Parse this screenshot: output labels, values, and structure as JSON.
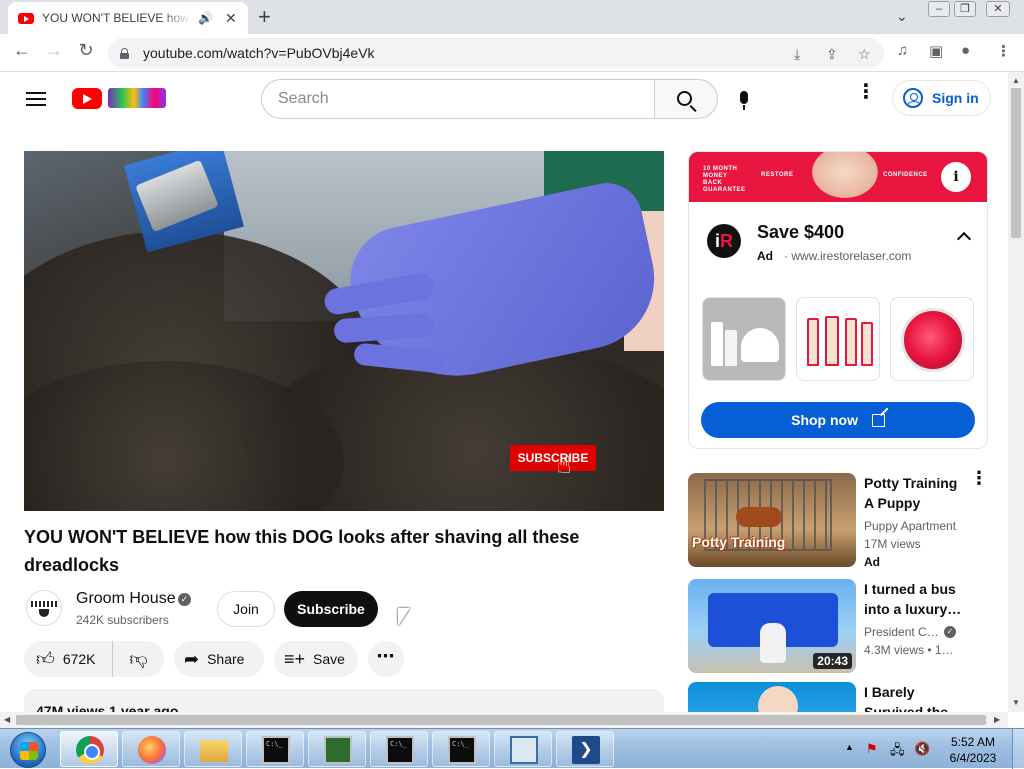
{
  "browser": {
    "tab_title": "YOU WON'T BELIEVE how this DOG looks after shaving all these dreadlocks",
    "url": "youtube.com/watch?v=PubOVbj4eVk",
    "audio_icon": "speaker-icon",
    "close_icon": "close-icon",
    "new_tab_icon": "plus-icon"
  },
  "youtube": {
    "search_placeholder": "Search",
    "sign_in": "Sign in"
  },
  "video": {
    "title": "YOU WON'T BELIEVE how this DOG looks after shaving all these dreadlocks",
    "overlay_subscribe": "SUBSCRIBE",
    "channel_name": "Groom House",
    "subscribers": "242K subscribers",
    "join": "Join",
    "subscribe": "Subscribe",
    "likes": "672K",
    "share": "Share",
    "save": "Save",
    "description_preview": "47M views  1 year ago"
  },
  "ad": {
    "banner_left": "10 MONTH MONEY BACK GUARANTEE",
    "banner_mid": "RESTORE",
    "banner_right": "CONFIDENCE",
    "title": "Save $400",
    "label": "Ad",
    "domain": "· www.irestorelaser.com",
    "cta": "Shop now",
    "accent": "#e8153f",
    "cta_color": "#065fd4"
  },
  "recommendations": [
    {
      "title": "Potty Training A Puppy",
      "channel": "Puppy Apartment",
      "meta": "17M views",
      "badge": "Ad",
      "thumb_text": "Potty Training"
    },
    {
      "title": "I turned a bus into a luxury…",
      "channel": "President C…",
      "meta": "4.3M views  •  1…",
      "duration": "20:43"
    },
    {
      "title": "I Barely Survived the…"
    }
  ],
  "taskbar": {
    "clock_time": "5:52 AM",
    "clock_date": "6/4/2023"
  }
}
